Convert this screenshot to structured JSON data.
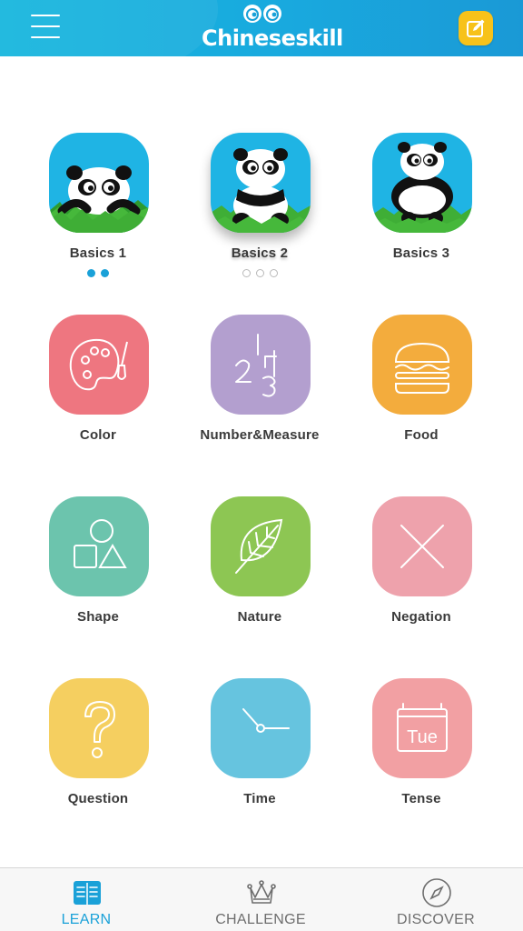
{
  "header": {
    "app_name": "Chineseskill",
    "menu_icon": "hamburger-menu-icon",
    "note_icon": "edit-note-icon",
    "colors": {
      "bar": "#18aadd",
      "note_button": "#f7c21a"
    }
  },
  "lessons": [
    {
      "label": "Basics 1",
      "icon": "panda-peeking-icon",
      "color": "#1fb4e4",
      "progress_dots": {
        "filled": 2,
        "total": 2
      }
    },
    {
      "label": "Basics 2",
      "icon": "panda-sitting-icon",
      "color": "#1fb4e4",
      "selected": true,
      "progress_dots": {
        "filled": 0,
        "total": 3
      }
    },
    {
      "label": "Basics 3",
      "icon": "panda-standing-icon",
      "color": "#1fb4e4"
    },
    {
      "label": "Color",
      "icon": "palette-icon",
      "color": "#ee7680"
    },
    {
      "label": "Number&Measure",
      "icon": "numbers-icon",
      "color": "#b39fcf"
    },
    {
      "label": "Food",
      "icon": "burger-icon",
      "color": "#f3ac3d"
    },
    {
      "label": "Shape",
      "icon": "shapes-icon",
      "color": "#6cc4ad"
    },
    {
      "label": "Nature",
      "icon": "leaf-icon",
      "color": "#8dc653"
    },
    {
      "label": "Negation",
      "icon": "cross-icon",
      "color": "#eea2ac"
    },
    {
      "label": "Question",
      "icon": "question-mark-icon",
      "color": "#f5cf60"
    },
    {
      "label": "Time",
      "icon": "clock-icon",
      "color": "#66c4df"
    },
    {
      "label": "Tense",
      "icon": "calendar-icon",
      "color": "#f2a0a3",
      "icon_text": "Tue"
    }
  ],
  "tabs": [
    {
      "label": "LEARN",
      "icon": "book-icon",
      "active": true
    },
    {
      "label": "CHALLENGE",
      "icon": "crown-icon",
      "active": false
    },
    {
      "label": "DISCOVER",
      "icon": "compass-icon",
      "active": false
    }
  ],
  "colors": {
    "accent": "#1aa1d8",
    "label_text": "#3a3a3a",
    "tab_inactive": "#6e6e6e"
  }
}
